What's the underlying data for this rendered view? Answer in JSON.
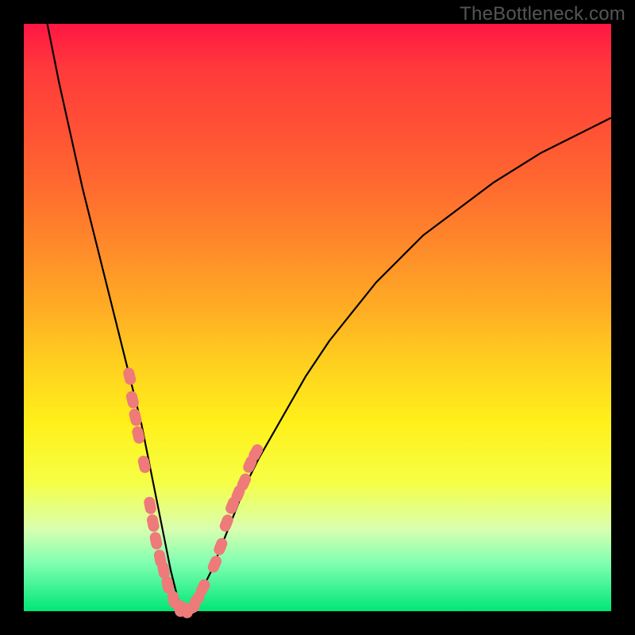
{
  "watermark": "TheBottleneck.com",
  "colors": {
    "curve_stroke": "#000000",
    "marker_fill": "#ee7a7a",
    "marker_stroke": "#b24a4a",
    "gradient_top": "#ff1744",
    "gradient_bottom": "#00e676",
    "page_bg": "#000000"
  },
  "chart_data": {
    "type": "line",
    "title": "",
    "xlabel": "",
    "ylabel": "",
    "xlim": [
      0,
      100
    ],
    "ylim": [
      0,
      100
    ],
    "curve": {
      "name": "bottleneck-curve",
      "x": [
        4,
        6,
        8,
        10,
        12,
        14,
        16,
        18,
        20,
        21,
        22,
        23,
        24,
        25,
        26,
        27,
        28,
        29,
        30,
        32,
        34,
        36,
        38,
        40,
        44,
        48,
        52,
        56,
        60,
        64,
        68,
        72,
        76,
        80,
        84,
        88,
        92,
        96,
        100
      ],
      "y": [
        100,
        90,
        81,
        72,
        64,
        56,
        48,
        40,
        32,
        27,
        22,
        17,
        12,
        7,
        3,
        0,
        0,
        1,
        3,
        7,
        12,
        17,
        22,
        26,
        33,
        40,
        46,
        51,
        56,
        60,
        64,
        67,
        70,
        73,
        75.5,
        78,
        80,
        82,
        84
      ]
    },
    "markers": [
      {
        "x": 18.0,
        "y": 40
      },
      {
        "x": 18.5,
        "y": 36
      },
      {
        "x": 19.0,
        "y": 33
      },
      {
        "x": 19.5,
        "y": 30
      },
      {
        "x": 20.5,
        "y": 25
      },
      {
        "x": 21.5,
        "y": 18
      },
      {
        "x": 22.0,
        "y": 15
      },
      {
        "x": 22.5,
        "y": 12
      },
      {
        "x": 23.2,
        "y": 9
      },
      {
        "x": 23.8,
        "y": 7
      },
      {
        "x": 24.5,
        "y": 4.5
      },
      {
        "x": 25.5,
        "y": 2
      },
      {
        "x": 26.5,
        "y": 0.5
      },
      {
        "x": 27.5,
        "y": 0.2
      },
      {
        "x": 28.5,
        "y": 0.5
      },
      {
        "x": 29.5,
        "y": 2
      },
      {
        "x": 30.5,
        "y": 4
      },
      {
        "x": 32.5,
        "y": 8
      },
      {
        "x": 33.5,
        "y": 11
      },
      {
        "x": 34.5,
        "y": 15
      },
      {
        "x": 35.5,
        "y": 18
      },
      {
        "x": 36.5,
        "y": 20
      },
      {
        "x": 37.5,
        "y": 22
      },
      {
        "x": 38.5,
        "y": 25
      },
      {
        "x": 39.5,
        "y": 27
      }
    ]
  }
}
